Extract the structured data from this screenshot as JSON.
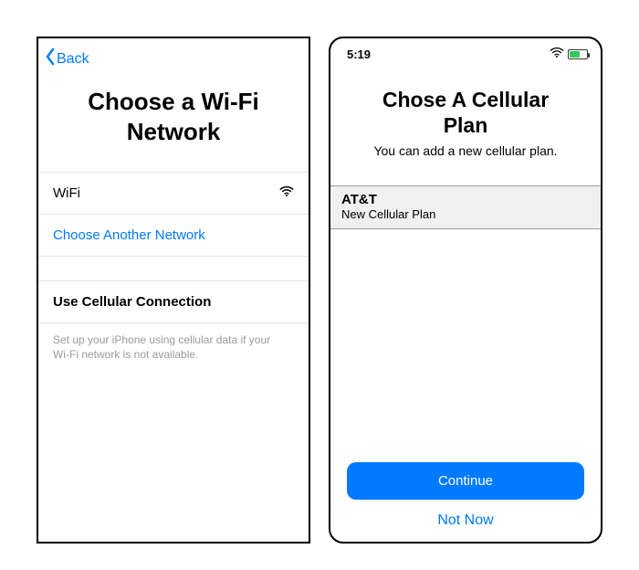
{
  "left": {
    "back_label": "Back",
    "title": "Choose a Wi‑Fi Network",
    "wifi_row": "WiFi",
    "choose_another": "Choose Another Network",
    "use_cellular": "Use Cellular Connection",
    "hint": "Set up your iPhone using cellular data if your Wi‑Fi network is not available."
  },
  "right": {
    "time": "5:19",
    "title": "Chose A Cellular Plan",
    "subtitle": "You can add a new cellular plan.",
    "carrier": "AT&T",
    "plan_sub": "New Cellular Plan",
    "continue": "Continue",
    "not_now": "Not Now"
  }
}
